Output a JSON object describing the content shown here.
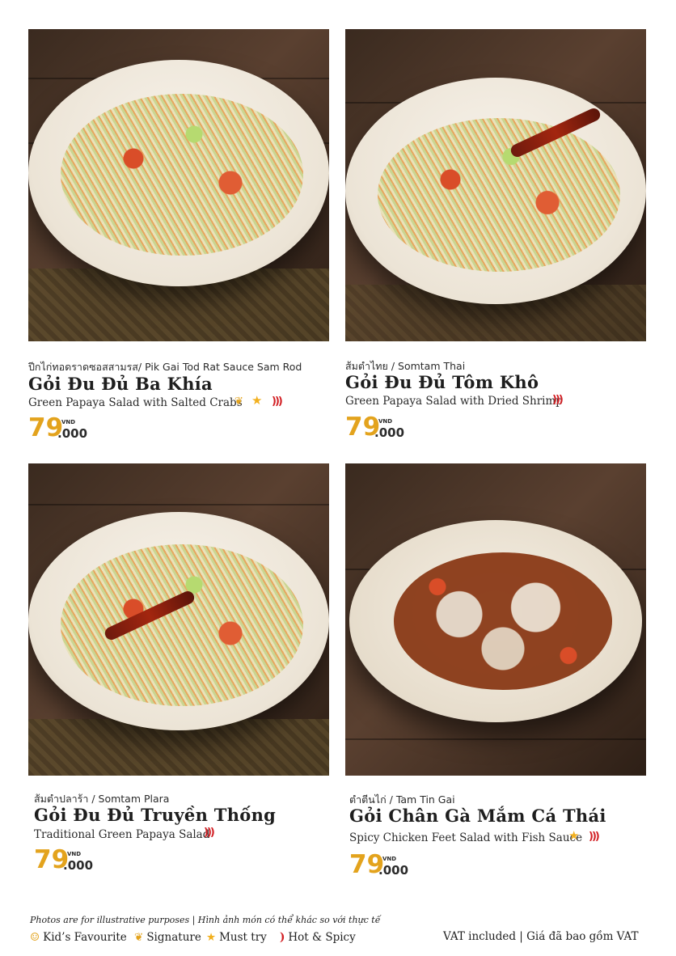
{
  "items": [
    {
      "thai_line": "ปีกไก่ทอดราดซอสสามรส/ Pik Gai Tod Rat Sauce Sam Rod",
      "vn_name": "Gỏi Đu Đủ Ba Khía",
      "en_desc": "Green Papaya Salad with Salted Crabs",
      "price_main": "79",
      "price_currency": "VND",
      "price_tail": ".000",
      "badges": [
        "signature-icon",
        "must-try-icon",
        "hot-spicy-icon"
      ]
    },
    {
      "thai_line": "ส้มตำไทย / Somtam Thai",
      "vn_name": "Gỏi Đu Đủ Tôm Khô",
      "en_desc": "Green Papaya Salad with Dried Shrimp",
      "price_main": "79",
      "price_currency": "VND",
      "price_tail": ".000",
      "badges": [
        "hot-spicy-icon"
      ]
    },
    {
      "thai_line": "ส้มตำปลาร้า / Somtam Plara",
      "vn_name": "Gỏi Đu Đủ Truyền Thống",
      "en_desc": "Traditional Green Papaya Salad",
      "price_main": "79",
      "price_currency": "VND",
      "price_tail": ".000",
      "badges": [
        "hot-spicy-icon"
      ]
    },
    {
      "thai_line": "ตำตีนไก่ / Tam Tin Gai",
      "vn_name": "Gỏi Chân Gà Mắm Cá Thái",
      "en_desc": "Spicy Chicken Feet Salad with Fish Sauce",
      "price_main": "79",
      "price_currency": "VND",
      "price_tail": ".000",
      "badges": [
        "must-try-icon",
        "hot-spicy-icon"
      ]
    }
  ],
  "footer": {
    "note": "Photos are for illustrative purposes | Hình ảnh món có thể khác so với thực tế",
    "legend": [
      {
        "icon": "kids-favourite-icon",
        "label": "Kid’s Favourite"
      },
      {
        "icon": "signature-icon",
        "label": "Signature"
      },
      {
        "icon": "must-try-icon",
        "label": "Must try"
      },
      {
        "icon": "hot-spicy-icon",
        "label": "Hot & Spicy"
      }
    ],
    "vat": "VAT included | Giá đã bao gồm VAT"
  },
  "colors": {
    "price": "#e3a31d",
    "star": "#f2b01e",
    "chili": "#d21f24"
  }
}
